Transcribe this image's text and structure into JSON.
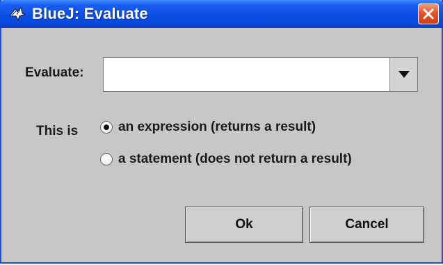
{
  "window": {
    "title": "BlueJ:  Evaluate",
    "app_icon": "bluej-bird-icon",
    "close_icon": "close-icon"
  },
  "form": {
    "evaluate_label": "Evaluate:",
    "evaluate_value": "",
    "dropdown_icon": "chevron-down-icon",
    "this_is_label": "This is",
    "options": [
      {
        "label": "an expression (returns a result)",
        "selected": true
      },
      {
        "label": "a statement (does not return a result)",
        "selected": false
      }
    ]
  },
  "buttons": {
    "ok_label": "Ok",
    "cancel_label": "Cancel"
  },
  "colors": {
    "titlebar": "#0a4ee4",
    "close": "#d23c12",
    "dialog_bg": "#c7c7c7"
  }
}
